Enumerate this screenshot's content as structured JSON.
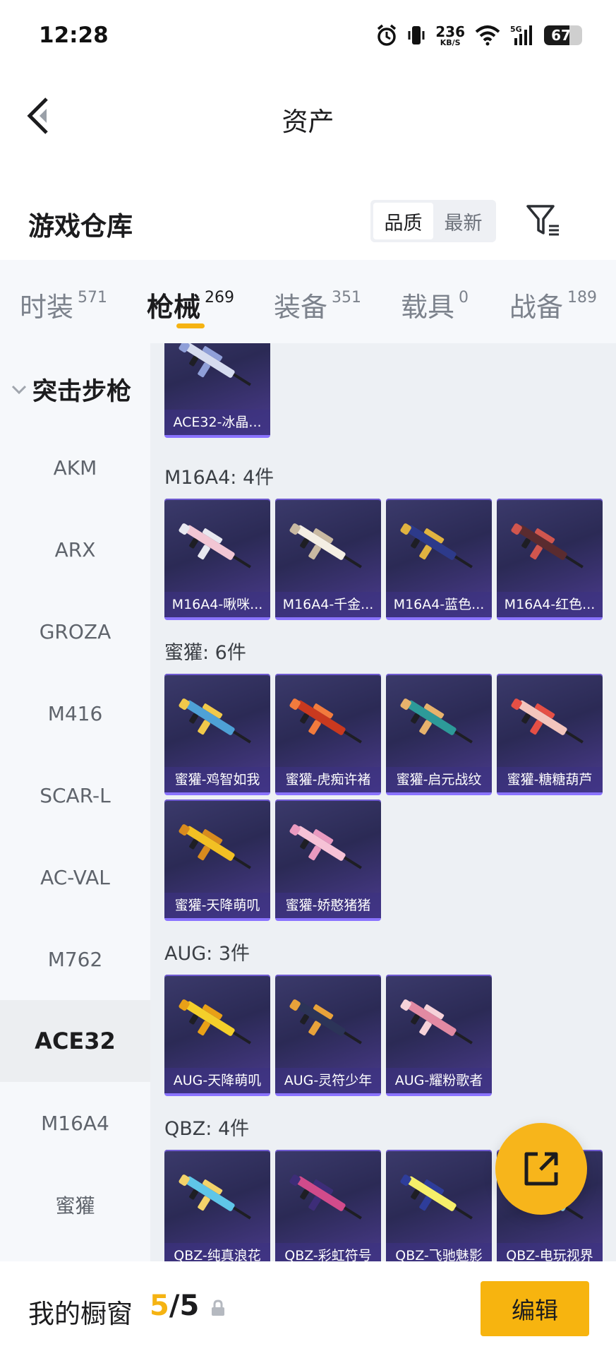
{
  "status_bar": {
    "time": "12:28",
    "net_speed_value": "236",
    "net_speed_unit": "KB/S",
    "network": "5G",
    "battery": "67",
    "icons": [
      "alarm-icon",
      "vibrate-icon",
      "wifi-icon",
      "signal-icon",
      "battery-icon"
    ]
  },
  "header": {
    "title": "资产",
    "back_icon": "back-arrow-icon"
  },
  "section": {
    "title": "游戏仓库",
    "sort_options": [
      "品质",
      "最新"
    ],
    "sort_selected": "品质",
    "filter_icon": "filter-icon"
  },
  "tabs": [
    {
      "label": "时装",
      "count": "571"
    },
    {
      "label": "枪械",
      "count": "269"
    },
    {
      "label": "装备",
      "count": "351"
    },
    {
      "label": "载具",
      "count": "0"
    },
    {
      "label": "战备",
      "count": "189"
    }
  ],
  "active_tab": "枪械",
  "sidebar": {
    "group": "突击步枪",
    "items": [
      "AKM",
      "ARX",
      "GROZA",
      "M416",
      "SCAR-L",
      "AC-VAL",
      "M762",
      "ACE32",
      "M16A4",
      "蜜獾"
    ],
    "selected": "ACE32"
  },
  "content": {
    "top_item": "ACE32-冰晶...",
    "groups": [
      {
        "title": "M16A4: 4件",
        "items": [
          "M16A4-啾咪...",
          "M16A4-千金...",
          "M16A4-蓝色...",
          "M16A4-红色..."
        ]
      },
      {
        "title": "蜜獾: 6件",
        "items": [
          "蜜獾-鸡智如我",
          "蜜獾-虎痴许褚",
          "蜜獾-启元战纹",
          "蜜獾-糖糖葫芦",
          "蜜獾-天降萌叽",
          "蜜獾-娇憨猪猪"
        ]
      },
      {
        "title": "AUG: 3件",
        "items": [
          "AUG-天降萌叽",
          "AUG-灵符少年",
          "AUG-耀粉歌者"
        ]
      },
      {
        "title": "QBZ: 4件",
        "items": [
          "QBZ-纯真浪花",
          "QBZ-彩虹符号",
          "QBZ-飞驰魅影",
          "QBZ-电玩视界"
        ]
      }
    ],
    "weapon_colors": {
      "ace32": [
        "#d6dcef",
        "#8f9fd8"
      ],
      "m16_1": [
        "#f2c6d4",
        "#e8e8f0"
      ],
      "m16_2": [
        "#f4eee4",
        "#c9b9a2"
      ],
      "m16_3": [
        "#2d3a8a",
        "#e0b340"
      ],
      "m16_4": [
        "#5a2b2f",
        "#d0564e"
      ],
      "honey_1": [
        "#4ea1d6",
        "#f1c94a"
      ],
      "honey_2": [
        "#c9391f",
        "#f27b3d"
      ],
      "honey_3": [
        "#2d9a99",
        "#e7b26c"
      ],
      "honey_4": [
        "#f3c5bd",
        "#e54f45"
      ],
      "honey_5": [
        "#f2c024",
        "#d88b1e"
      ],
      "honey_6": [
        "#f6c2d6",
        "#ea9ac0"
      ],
      "aug_1": [
        "#f4cf2a",
        "#e8a017"
      ],
      "aug_2": [
        "#2c3458",
        "#e8a23a"
      ],
      "aug_3": [
        "#e28aa3",
        "#f6d2d9"
      ],
      "qbz_1": [
        "#5fc6e8",
        "#f3d36a"
      ],
      "qbz_2": [
        "#d14b8b",
        "#3d2d78"
      ],
      "qbz_3": [
        "#f6ef6a",
        "#2e3d9a"
      ],
      "qbz_4": [
        "#9adbe5",
        "#ef7aa6"
      ]
    }
  },
  "fab": {
    "icon": "share-external-icon"
  },
  "bottom_bar": {
    "label": "我的橱窗",
    "count_current": "5",
    "count_sep": "/",
    "count_total": "5",
    "lock_icon": "lock-icon",
    "edit_label": "编辑"
  }
}
